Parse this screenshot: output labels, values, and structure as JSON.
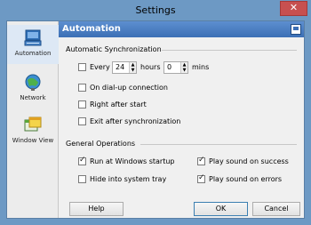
{
  "window": {
    "title": "Settings",
    "close_glyph": "✕"
  },
  "sidebar": {
    "items": [
      {
        "label": "Automation",
        "icon": "automation-icon",
        "selected": true
      },
      {
        "label": "Network",
        "icon": "network-icon",
        "selected": false
      },
      {
        "label": "Window View",
        "icon": "window-view-icon",
        "selected": false
      }
    ]
  },
  "header": {
    "title": "Automation",
    "icon": "panel-icon"
  },
  "auto_sync": {
    "group_title": "Automatic Synchronization",
    "every": {
      "label": "Every",
      "checked": false
    },
    "hours": {
      "value": "24",
      "unit": "hours"
    },
    "mins": {
      "value": "0",
      "unit": "mins"
    },
    "dialup": {
      "label": "On dial-up connection",
      "checked": false
    },
    "right_after_start": {
      "label": "Right after start",
      "checked": false
    },
    "exit_after_sync": {
      "label": "Exit after synchronization",
      "checked": false
    }
  },
  "general": {
    "group_title": "General Operations",
    "run_startup": {
      "label": "Run at Windows startup",
      "checked": true
    },
    "hide_tray": {
      "label": "Hide into system tray",
      "checked": false
    },
    "sound_success": {
      "label": "Play sound on success",
      "checked": true
    },
    "sound_errors": {
      "label": "Play sound on errors",
      "checked": true
    }
  },
  "buttons": {
    "help": "Help",
    "ok": "OK",
    "cancel": "Cancel"
  },
  "colors": {
    "frame": "#6d99c4",
    "header": "#3c6fb5",
    "close": "#c75050"
  }
}
